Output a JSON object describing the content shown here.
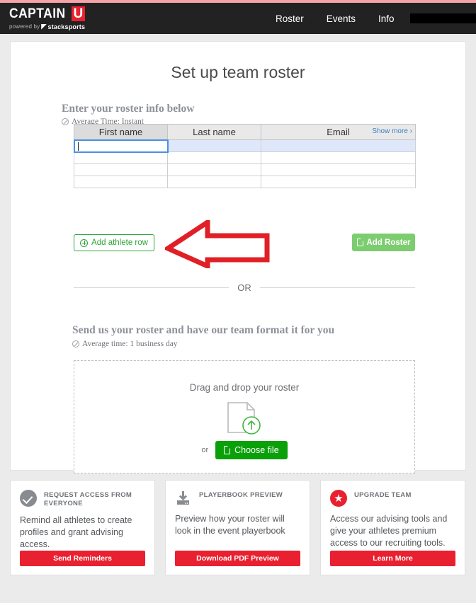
{
  "header": {
    "logo_text": "CAPTAIN",
    "logo_badge": "U",
    "logo_powered": "powered by",
    "logo_brand_mark": "◤",
    "logo_brand": "stacksports",
    "nav": [
      {
        "label": "Roster"
      },
      {
        "label": "Events"
      },
      {
        "label": "Info"
      }
    ],
    "user_menu_label": "",
    "accent_color": "#f5a3a8",
    "background_color": "#222223"
  },
  "main": {
    "page_title": "Set up team roster",
    "section1": {
      "heading": "Enter your roster info below",
      "average_time": "Average Time: Instant"
    },
    "table": {
      "columns": [
        "First name",
        "Last name",
        "Email"
      ],
      "show_more_label": "Show more ›",
      "rows": [
        {
          "first": "",
          "last": "",
          "email": "",
          "active": true
        },
        {
          "first": "",
          "last": "",
          "email": "",
          "active": false
        },
        {
          "first": "",
          "last": "",
          "email": "",
          "active": false
        },
        {
          "first": "",
          "last": "",
          "email": "",
          "active": false
        }
      ],
      "focused_cell_value": ""
    },
    "add_athlete_row_label": "Add athlete row",
    "add_roster_label": "Add Roster",
    "or_label": "OR",
    "section2": {
      "heading": "Send us your roster and have our team format it for you",
      "average_time": "Average time: 1 business day"
    },
    "dropzone": {
      "text": "Drag and drop your roster",
      "or_label": "or",
      "choose_file_label": "Choose file"
    },
    "annotation": {
      "type": "left-arrow",
      "color": "#e01f26"
    }
  },
  "cards": [
    {
      "icon": "check-circle-icon",
      "title": "REQUEST ACCESS FROM EVERYONE",
      "description": "Remind all athletes to create profiles and grant advising access.",
      "button_label": "Send Reminders",
      "button_color": "#e8202f"
    },
    {
      "icon": "download-icon",
      "title": "PLAYERBOOK PREVIEW",
      "description": "Preview how your roster will look in the event playerbook",
      "button_label": "Download PDF Preview",
      "button_color": "#e8202f"
    },
    {
      "icon": "star-circle-icon",
      "title": "UPGRADE TEAM",
      "description": "Access our advising tools and give your athletes premium access to our recruiting tools.",
      "button_label": "Learn More",
      "button_color": "#e8202f"
    }
  ]
}
